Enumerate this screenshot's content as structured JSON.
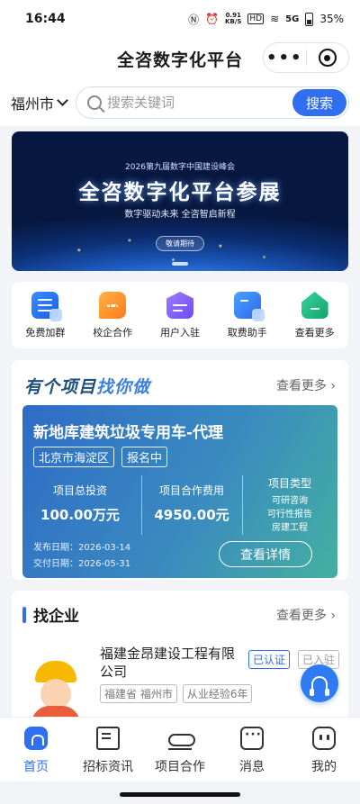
{
  "status": {
    "time": "16:44",
    "net_speed": "0.91",
    "net_unit": "KB/S",
    "hd": "HD",
    "signal": "5G",
    "battery": "35%"
  },
  "app": {
    "title": "全咨数字化平台",
    "more_icon": "more-dots-icon",
    "close_icon": "target-close-icon"
  },
  "search": {
    "city": "福州市",
    "placeholder": "搜索关键词",
    "button": "搜索"
  },
  "banner": {
    "sub": "2026第九届数字中国建设峰会",
    "title": "全咨数字化平台参展",
    "slogan": "数字驱动未来  全咨智启新程",
    "cta": "敬请期待"
  },
  "quick": [
    {
      "label": "免费加群",
      "icon": "group-list-icon"
    },
    {
      "label": "校企合作",
      "icon": "chat-bubble-icon"
    },
    {
      "label": "用户入驻",
      "icon": "user-entry-icon"
    },
    {
      "label": "取费助手",
      "icon": "fee-helper-icon"
    },
    {
      "label": "查看更多",
      "icon": "more-house-icon"
    }
  ],
  "project": {
    "section_logo_a": "有个项目",
    "section_logo_b": "找你做",
    "more": "查看更多 ›",
    "name": "新地库建筑垃圾专用车-代理",
    "region": "北京市海淀区",
    "status": "报名中",
    "investment_label": "项目总投资",
    "investment": "100.00万元",
    "fee_label": "项目合作费用",
    "fee": "4950.00元",
    "type_label": "项目类型",
    "types": [
      "可研咨询",
      "可行性报告",
      "房建工程"
    ],
    "publish_date": "发布日期：2026-03-14",
    "delivery_date": "交付日期：2026-05-31",
    "detail_button": "查看详情"
  },
  "enterprise": {
    "title": "找企业",
    "more": "查看更多 ›",
    "name": "福建金昂建设工程有限公司",
    "verified": "已认证",
    "joined": "已入驻",
    "location": "福建省 福州市",
    "experience": "从业经验6年"
  },
  "tabs": [
    {
      "label": "首页",
      "icon": "home-icon",
      "active": true
    },
    {
      "label": "招标资讯",
      "icon": "bid-news-icon",
      "active": false
    },
    {
      "label": "项目合作",
      "icon": "handshake-icon",
      "active": false
    },
    {
      "label": "消息",
      "icon": "message-icon",
      "active": false
    },
    {
      "label": "我的",
      "icon": "profile-icon",
      "active": false
    }
  ],
  "colors": {
    "accent": "#2f6ff0",
    "project_grad_start": "#2e6cc6",
    "project_grad_end": "#44b0a0"
  }
}
